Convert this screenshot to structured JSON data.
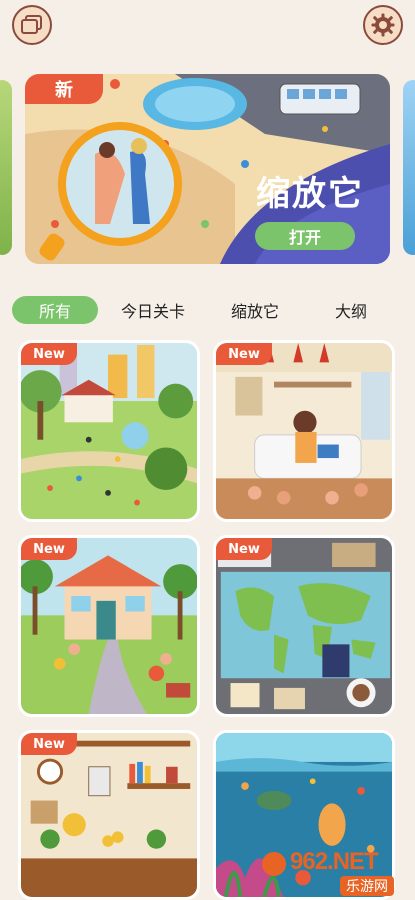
{
  "topbar": {
    "left_icon": "gallery-icon",
    "right_icon": "gear-icon"
  },
  "banner": {
    "badge": "新",
    "title": "缩放它",
    "button_label": "打开"
  },
  "tabs": [
    {
      "label": "所有",
      "active": true
    },
    {
      "label": "今日关卡",
      "active": false
    },
    {
      "label": "缩放它",
      "active": false
    },
    {
      "label": "大纲",
      "active": false
    }
  ],
  "cards": [
    {
      "badge": "New",
      "theme": "park"
    },
    {
      "badge": "New",
      "theme": "living-room"
    },
    {
      "badge": "New",
      "theme": "house-yard"
    },
    {
      "badge": "New",
      "theme": "world-map-desk"
    },
    {
      "badge": "New",
      "theme": "shelf-room"
    },
    {
      "badge": "",
      "theme": "underwater"
    }
  ],
  "watermark": {
    "main": "962.NET",
    "sub": "乐游网"
  },
  "colors": {
    "accent_green": "#7cc46c",
    "badge_red": "#e85a3a",
    "background": "#f6efe8"
  }
}
